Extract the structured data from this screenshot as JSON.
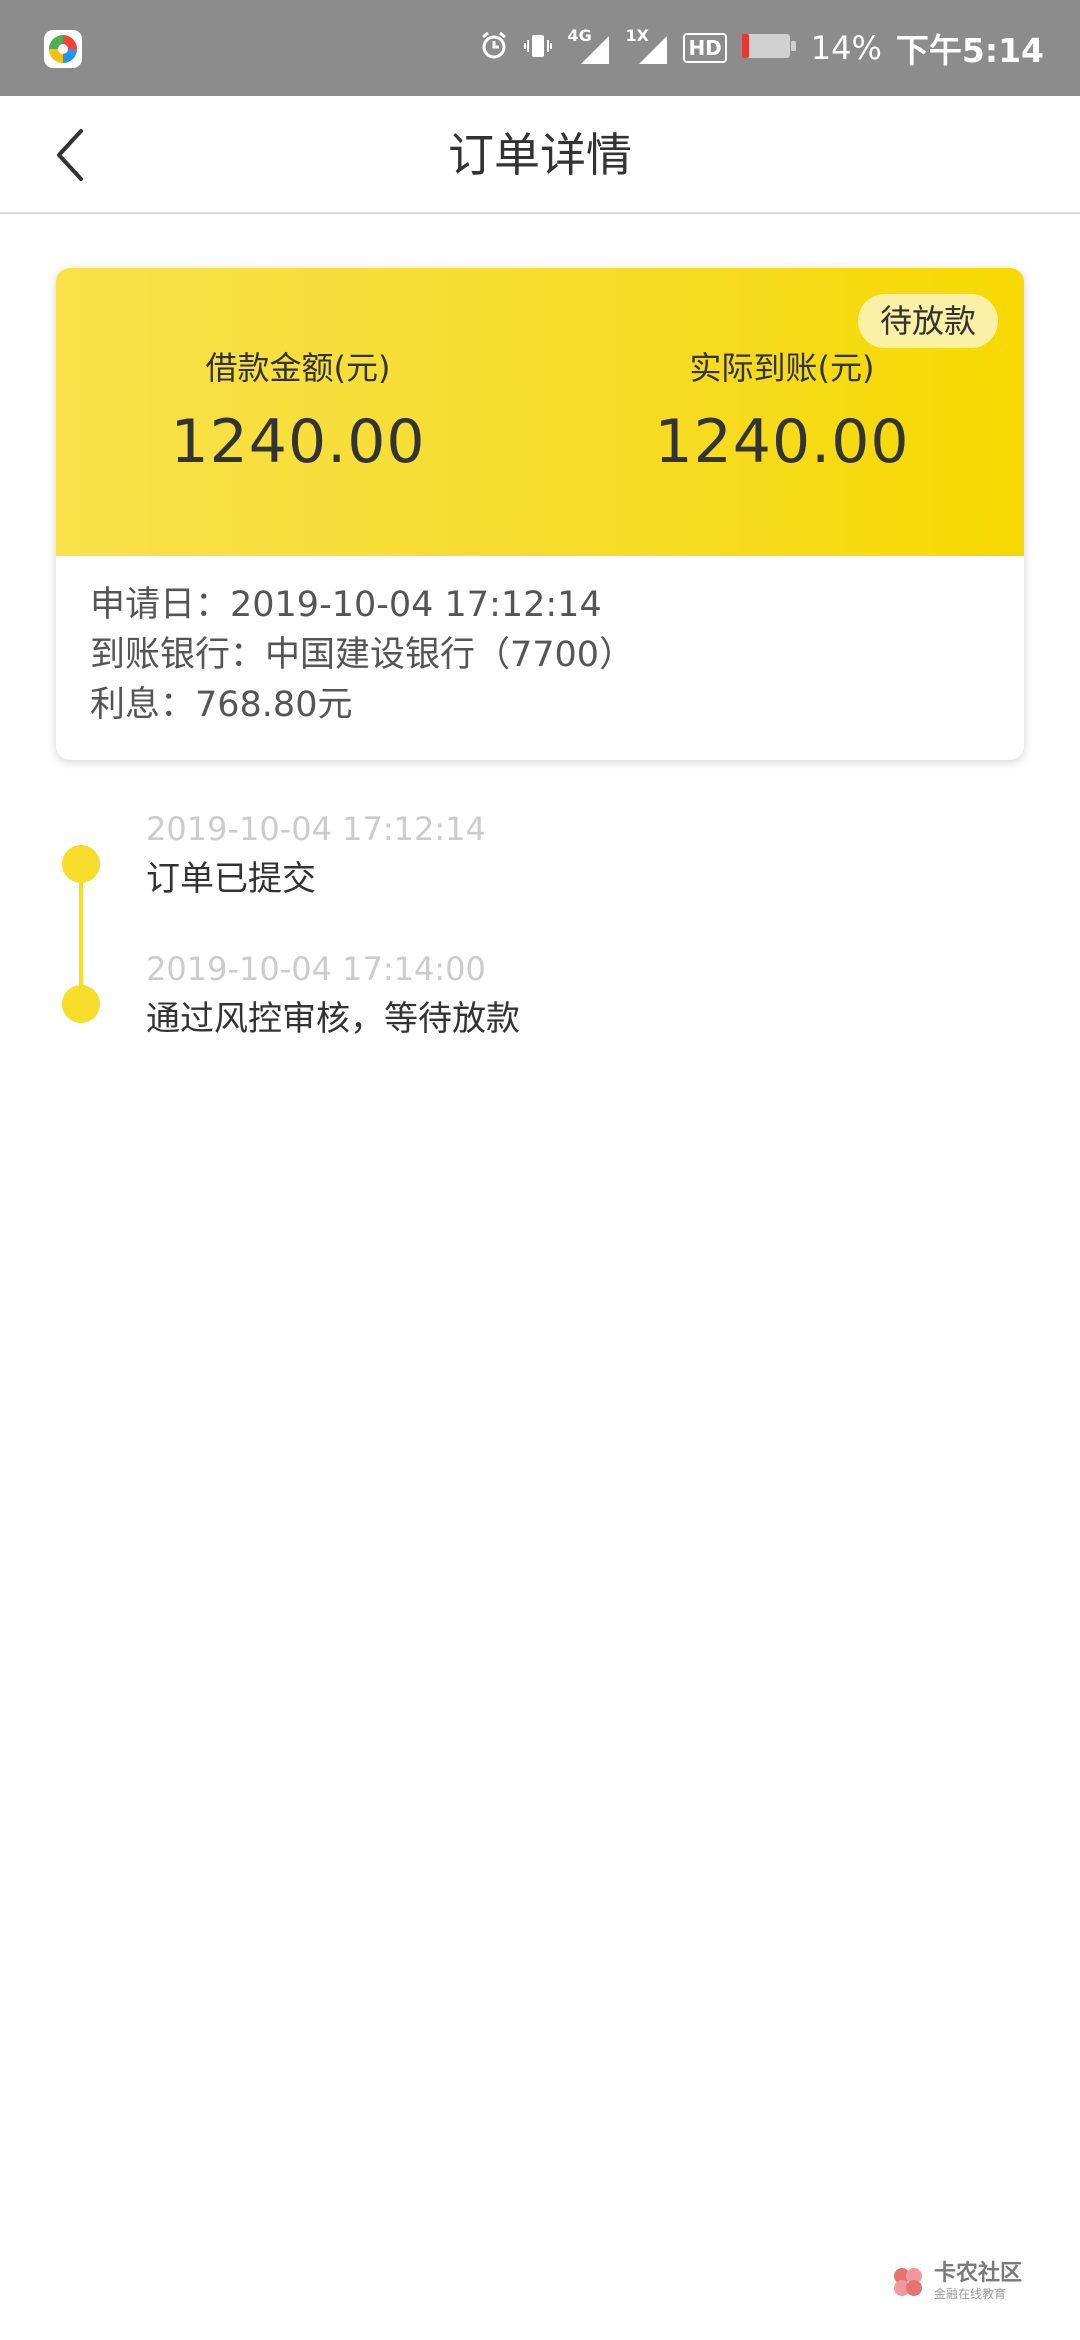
{
  "status_bar": {
    "network_4g": "4G",
    "network_1x": "1X",
    "hd": "HD",
    "battery": "14%",
    "time": "下午5:14",
    "colors": {
      "background": "#8c8c8c",
      "battery_low": "#e53935"
    }
  },
  "header": {
    "title": "订单详情"
  },
  "card": {
    "badge": "待放款",
    "loan_amount_label": "借款金额(元)",
    "loan_amount_value": "1240.00",
    "received_amount_label": "实际到账(元)",
    "received_amount_value": "1240.00",
    "info": [
      "申请日：2019-10-04 17:12:14",
      "到账银行：中国建设银行（7700）",
      "利息：768.80元"
    ],
    "colors": {
      "accent": "#f7dc2a",
      "badge_bg": "#fbf0a6"
    }
  },
  "timeline": [
    {
      "time": "2019-10-04 17:12:14",
      "text": "订单已提交"
    },
    {
      "time": "2019-10-04 17:14:00",
      "text": "通过风控审核，等待放款"
    }
  ],
  "watermark": {
    "title": "卡农社区",
    "subtitle": "金融在线教育"
  }
}
